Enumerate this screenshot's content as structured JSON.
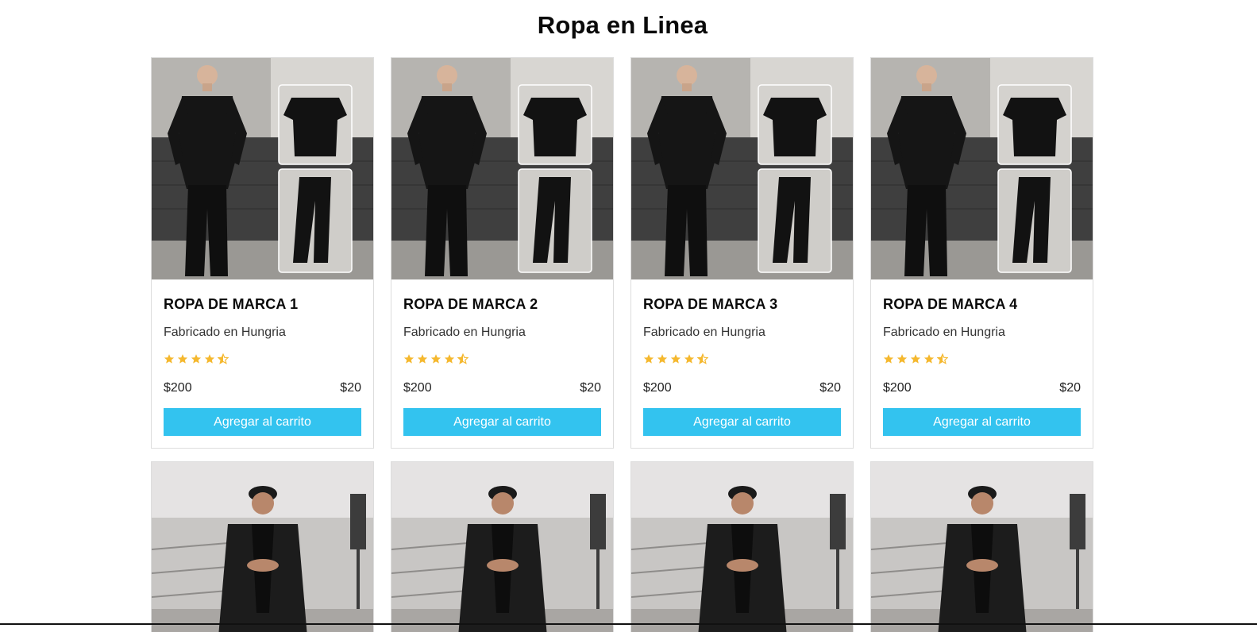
{
  "header": {
    "title": "Ropa en Linea"
  },
  "products": [
    {
      "name": "ROPA DE MARCA 1",
      "origin": "Fabricado en Hungria",
      "rating": 4.5,
      "price": "$200",
      "shipping": "$20",
      "button": "Agregar al carrito"
    },
    {
      "name": "ROPA DE MARCA 2",
      "origin": "Fabricado en Hungria",
      "rating": 4.5,
      "price": "$200",
      "shipping": "$20",
      "button": "Agregar al carrito"
    },
    {
      "name": "ROPA DE MARCA 3",
      "origin": "Fabricado en Hungria",
      "rating": 4.5,
      "price": "$200",
      "shipping": "$20",
      "button": "Agregar al carrito"
    },
    {
      "name": "ROPA DE MARCA 4",
      "origin": "Fabricado en Hungria",
      "rating": 4.5,
      "price": "$200",
      "shipping": "$20",
      "button": "Agregar al carrito"
    }
  ],
  "products_row2_count": 4,
  "colors": {
    "accent": "#33c3ef",
    "star": "#f5b82e",
    "border": "#dddddd"
  },
  "icons": {
    "star": "star-icon",
    "half_star": "star-half-icon"
  }
}
